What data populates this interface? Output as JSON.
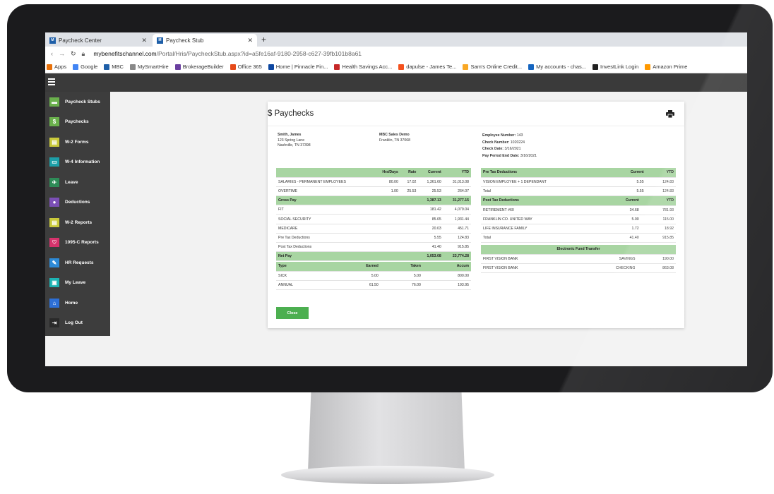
{
  "browser": {
    "tabs": [
      {
        "label": "Paycheck Center",
        "close": "✕"
      },
      {
        "label": "Paycheck Stub",
        "close": "✕"
      }
    ],
    "new_tab": "+",
    "url_host": "mybenefitschannel.com",
    "url_path": "/Portal/Hris/PaycheckStub.aspx?id=a5fe16af-9180-2958-c627-39fb101b8a61",
    "bookmarks": [
      {
        "label": "Apps",
        "icon": "apps-icon",
        "color": "#e8710a"
      },
      {
        "label": "Google",
        "icon": "google-icon",
        "color": "#4285f4"
      },
      {
        "label": "MBC",
        "icon": "mbc-icon",
        "color": "#1e5fa8"
      },
      {
        "label": "MySmartHire",
        "icon": "mysmarthire-icon",
        "color": "#888888"
      },
      {
        "label": "BrokerageBuilder",
        "icon": "brokeragebuilder-icon",
        "color": "#6a3fa0"
      },
      {
        "label": "Office 365",
        "icon": "office365-icon",
        "color": "#e64a19"
      },
      {
        "label": "Home | Pinnacle Fin...",
        "icon": "pinnacle-icon",
        "color": "#0d47a1"
      },
      {
        "label": "Health Savings Acc...",
        "icon": "health-savings-icon",
        "color": "#c62828"
      },
      {
        "label": "dapulse - James Te...",
        "icon": "dapulse-icon",
        "color": "#f4511e"
      },
      {
        "label": "Sam's Online Credit...",
        "icon": "sams-icon",
        "color": "#f9a825"
      },
      {
        "label": "My accounts - chas...",
        "icon": "chase-icon",
        "color": "#1565c0"
      },
      {
        "label": "InvestLink Login",
        "icon": "investlink-icon",
        "color": "#212121"
      },
      {
        "label": "Amazon Prime",
        "icon": "amazon-icon",
        "color": "#ff9900"
      }
    ]
  },
  "sidebar": {
    "items": [
      {
        "label": "Paycheck Stubs",
        "icon": "paycheck-stubs-icon",
        "color": "#6ab04c",
        "glyph": "▬"
      },
      {
        "label": "Paychecks",
        "icon": "dollar-icon",
        "color": "#6ab04c",
        "glyph": "$"
      },
      {
        "label": "W-2 Forms",
        "icon": "w2-forms-icon",
        "color": "#c9c93a",
        "glyph": "▤"
      },
      {
        "label": "W-4 Information",
        "icon": "w4-info-icon",
        "color": "#1d9fa8",
        "glyph": "▭"
      },
      {
        "label": "Leave",
        "icon": "plane-icon",
        "color": "#2e8b57",
        "glyph": "✈"
      },
      {
        "label": "Deductions",
        "icon": "deductions-icon",
        "color": "#7b4fb5",
        "glyph": "●"
      },
      {
        "label": "W-2 Reports",
        "icon": "w2-reports-icon",
        "color": "#c9c93a",
        "glyph": "▤"
      },
      {
        "label": "1095-C Reports",
        "icon": "heartbeat-icon",
        "color": "#d6336c",
        "glyph": "♡"
      },
      {
        "label": "HR Requests",
        "icon": "hr-requests-icon",
        "color": "#2d8ad6",
        "glyph": "✎"
      },
      {
        "label": "My Leave",
        "icon": "my-leave-icon",
        "color": "#1db3b3",
        "glyph": "▣"
      },
      {
        "label": "Home",
        "icon": "home-icon",
        "color": "#2d6fd6",
        "glyph": "⌂"
      },
      {
        "label": "Log Out",
        "icon": "logout-icon",
        "color": "#2a2a2a",
        "glyph": "⇥"
      }
    ]
  },
  "page": {
    "title": "$ Paychecks",
    "employee_name": "Smith, James",
    "employee_address1": "123 Spring Lane",
    "employee_address2": "Nashville, TN 37398",
    "company_name": "MBC Sales Demo",
    "company_city": "Franklin, TN 37068",
    "employee_number_label": "Employee Number:",
    "employee_number": "143",
    "check_number_label": "Check Number:",
    "check_number": "1020224",
    "check_date_label": "Check Date:",
    "check_date": "3/16/2021",
    "pay_period_label": "Pay Period End Date:",
    "pay_period": "3/16/2021",
    "close_label": "Close"
  },
  "earnings": {
    "headers": [
      "",
      "Hrs/Days",
      "Rate",
      "Current",
      "YTD"
    ],
    "rows": [
      {
        "label": "SALARIES - PERMANENT EMPLOYEES",
        "hrs": "80.00",
        "rate": "17.02",
        "current": "1,361.60",
        "ytd": "31,013.08",
        "highlight": false
      },
      {
        "label": "OVERTIME",
        "hrs": "1.00",
        "rate": "25.53",
        "current": "25.53",
        "ytd": "264.07",
        "highlight": false
      },
      {
        "label": "Gross Pay",
        "hrs": "",
        "rate": "",
        "current": "1,387.13",
        "ytd": "31,277.15",
        "highlight": true
      },
      {
        "label": "FIT",
        "hrs": "",
        "rate": "",
        "current": "181.42",
        "ytd": "4,079.04",
        "highlight": false
      },
      {
        "label": "SOCIAL SECURITY",
        "hrs": "",
        "rate": "",
        "current": "85.65",
        "ytd": "1,931.44",
        "highlight": false
      },
      {
        "label": "MEDICARE",
        "hrs": "",
        "rate": "",
        "current": "20.03",
        "ytd": "451.71",
        "highlight": false
      },
      {
        "label": "Pre Tax Deductions",
        "hrs": "",
        "rate": "",
        "current": "5.55",
        "ytd": "124.83",
        "highlight": false
      },
      {
        "label": "Post Tax Deductions",
        "hrs": "",
        "rate": "",
        "current": "41.40",
        "ytd": "915.85",
        "highlight": false
      },
      {
        "label": "Net Pay",
        "hrs": "",
        "rate": "",
        "current": "1,053.08",
        "ytd": "23,774.28",
        "highlight": true
      }
    ]
  },
  "leave": {
    "headers": [
      "Type",
      "Earned",
      "Taken",
      "Accum"
    ],
    "rows": [
      {
        "type": "SICK",
        "earned": "5.00",
        "taken": "5.00",
        "accum": "800.00"
      },
      {
        "type": "ANNUAL",
        "earned": "61.50",
        "taken": "76.00",
        "accum": "193.95"
      }
    ]
  },
  "deductions": {
    "pre_tax_header": [
      "Pre Tax Deductions",
      "Current",
      "YTD"
    ],
    "pre_tax_rows": [
      {
        "label": "VISION EMPLOYEE + 1 DEPENDANT",
        "current": "5.55",
        "ytd": "124.83"
      },
      {
        "label": "Total",
        "current": "5.55",
        "ytd": "124.83"
      }
    ],
    "post_tax_header": [
      "Post Tax Deductions",
      "Current",
      "YTD"
    ],
    "post_tax_rows": [
      {
        "label": "RETIREMENT #60",
        "current": "34.68",
        "ytd": "781.93"
      },
      {
        "label": "FRANKLIN CO. UNITED WAY",
        "current": "5.00",
        "ytd": "115.00"
      },
      {
        "label": "LIFE INSURANCE FAMILY",
        "current": "1.72",
        "ytd": "18.92"
      },
      {
        "label": "Total",
        "current": "41.40",
        "ytd": "915.85"
      }
    ],
    "eft_header": "Electronic Fund Transfer",
    "eft_rows": [
      {
        "bank": "FIRST VISION BANK",
        "type": "SAVINGS",
        "amount": "190.00"
      },
      {
        "bank": "FIRST VISION BANK",
        "type": "CHECKING",
        "amount": "863.08"
      }
    ]
  }
}
